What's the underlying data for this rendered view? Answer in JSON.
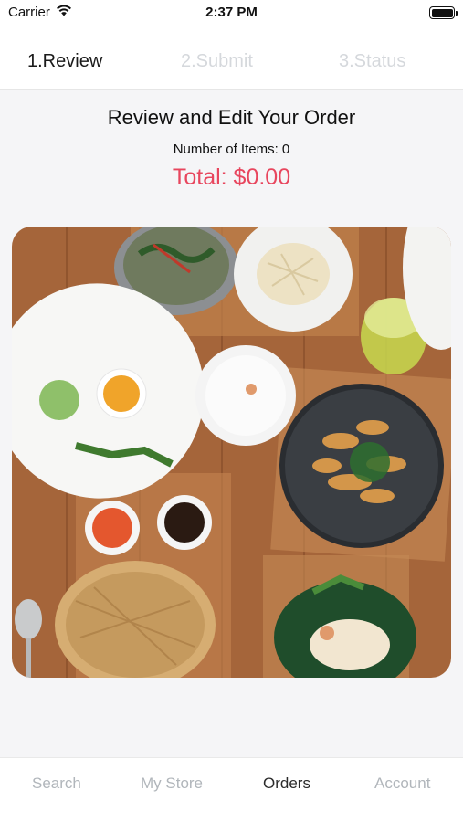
{
  "status_bar": {
    "carrier": "Carrier",
    "time": "2:37 PM",
    "icons": [
      "wifi-icon",
      "battery-icon"
    ]
  },
  "steps": [
    {
      "label": "1.Review",
      "state": "active"
    },
    {
      "label": "2.Submit",
      "state": "inactive"
    },
    {
      "label": "3.Status",
      "state": "inactive"
    }
  ],
  "order": {
    "title": "Review and Edit Your Order",
    "items_count": "Number of Items: 0",
    "total": "Total: $0.00"
  },
  "tabs": [
    {
      "label": "Search",
      "active": false
    },
    {
      "label": "My Store",
      "active": false
    },
    {
      "label": "Orders",
      "active": true
    },
    {
      "label": "Account",
      "active": false
    }
  ],
  "colors": {
    "accent": "#e8465e",
    "inactive_text": "#b1b6bb",
    "background": "#f5f5f7"
  }
}
